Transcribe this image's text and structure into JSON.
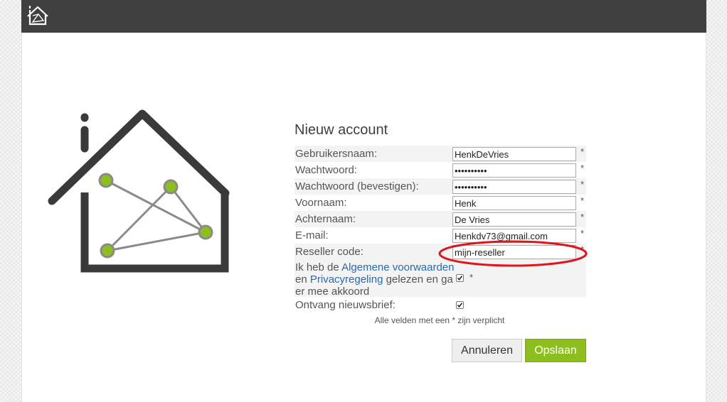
{
  "header": {
    "logo_icon": "home-network-logo-icon"
  },
  "form": {
    "title": "Nieuw account",
    "fields": {
      "username": {
        "label": "Gebruikersnaam:",
        "value": "HenkDeVries",
        "required": "*"
      },
      "password": {
        "label": "Wachtwoord:",
        "value": "••••••••••",
        "required": "*"
      },
      "password_confirm": {
        "label": "Wachtwoord (bevestigen):",
        "value": "••••••••••",
        "required": "*"
      },
      "firstname": {
        "label": "Voornaam:",
        "value": "Henk",
        "required": "*"
      },
      "lastname": {
        "label": "Achternaam:",
        "value": "De Vries",
        "required": "*"
      },
      "email": {
        "label": "E-mail:",
        "value": "Henkdv73@gmail.com",
        "required": "*"
      },
      "reseller": {
        "label": "Reseller code:",
        "value": "mijn-reseller",
        "required": "*"
      }
    },
    "terms": {
      "prefix": "Ik heb de ",
      "link_terms": "Algemene voorwaarden",
      "middle": " en ",
      "link_privacy": "Privacyregeling",
      "suffix": " gelezen en ga er mee akkoord",
      "checked": true,
      "required": "*"
    },
    "newsletter": {
      "label": "Ontvang nieuwsbrief:",
      "checked": true
    },
    "required_note": "Alle velden met een * zijn verplicht",
    "buttons": {
      "cancel": "Annuleren",
      "save": "Opslaan"
    }
  },
  "colors": {
    "header_bg": "#404040",
    "save_button": "#8cbf1e",
    "logo_node": "#8cbf1e",
    "annotation_circle": "#e0141b",
    "link": "#2a6ab0"
  }
}
